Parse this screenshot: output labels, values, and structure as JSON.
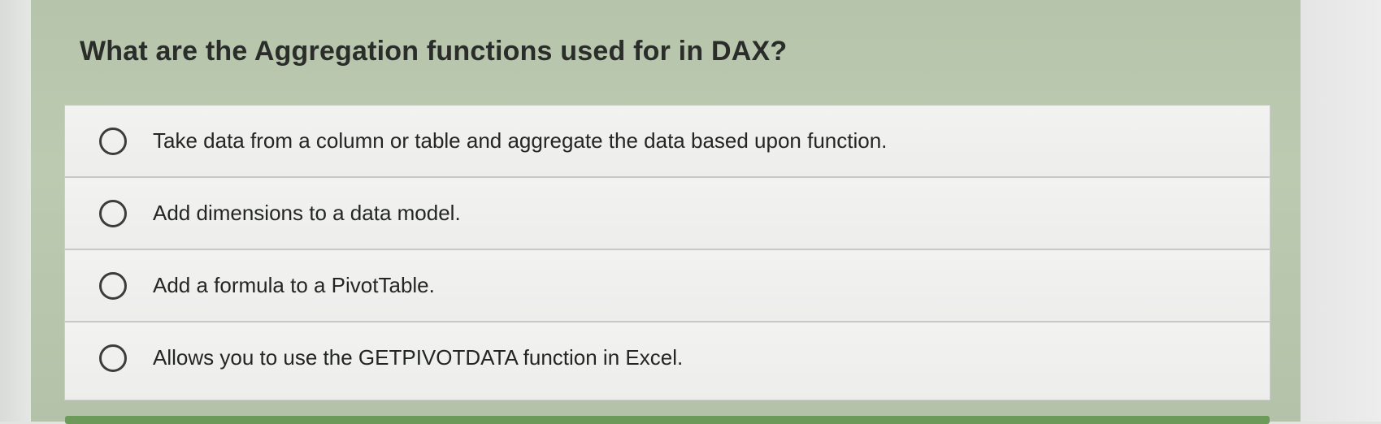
{
  "quiz": {
    "question": "What are the Aggregation functions used for in DAX?",
    "options": [
      {
        "label": "Take data from a column or table and aggregate the data based upon function."
      },
      {
        "label": "Add dimensions to a data model."
      },
      {
        "label": "Add a formula to a PivotTable."
      },
      {
        "label": "Allows you to use the GETPIVOTDATA function in Excel."
      }
    ]
  }
}
